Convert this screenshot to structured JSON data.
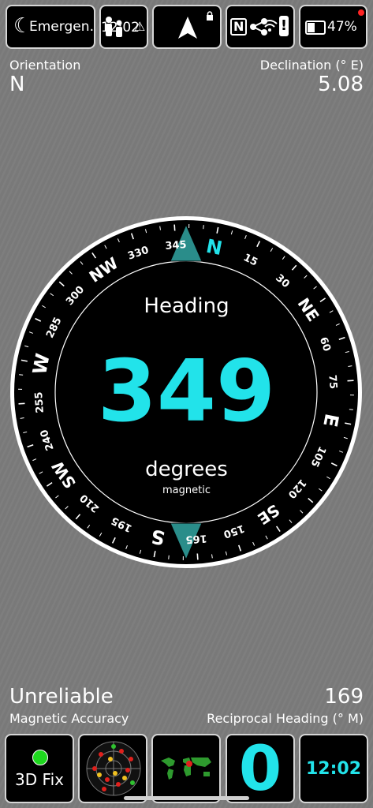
{
  "status_bar": {
    "emergency_text": "Emergen…",
    "time_text": "12:02",
    "warning_glyph": "⚠",
    "nfc_glyph": "N",
    "battery_text": "47%"
  },
  "info_top": {
    "orientation_label": "Orientation",
    "orientation_value": "N",
    "declination_label": "Declination (° E)",
    "declination_value": "5.08"
  },
  "compass": {
    "heading_label": "Heading",
    "heading_value": "349",
    "units_label": "degrees",
    "mode_label": "magnetic",
    "heading_deg": 349,
    "accent_color": "#22e3ea",
    "marker_color": "#2a8d8a",
    "cardinals": [
      {
        "label": "N",
        "bearing": 0
      },
      {
        "label": "NE",
        "bearing": 45
      },
      {
        "label": "E",
        "bearing": 90
      },
      {
        "label": "SE",
        "bearing": 135
      },
      {
        "label": "S",
        "bearing": 180
      },
      {
        "label": "SW",
        "bearing": 225
      },
      {
        "label": "W",
        "bearing": 270
      },
      {
        "label": "NW",
        "bearing": 315
      }
    ],
    "degree_labels": [
      {
        "label": "15",
        "bearing": 15
      },
      {
        "label": "30",
        "bearing": 30
      },
      {
        "label": "60",
        "bearing": 60
      },
      {
        "label": "75",
        "bearing": 75
      },
      {
        "label": "105",
        "bearing": 105
      },
      {
        "label": "120",
        "bearing": 120
      },
      {
        "label": "150",
        "bearing": 150
      },
      {
        "label": "165",
        "bearing": 165
      },
      {
        "label": "195",
        "bearing": 195
      },
      {
        "label": "210",
        "bearing": 210
      },
      {
        "label": "240",
        "bearing": 240
      },
      {
        "label": "255",
        "bearing": 255
      },
      {
        "label": "285",
        "bearing": 285
      },
      {
        "label": "300",
        "bearing": 300
      },
      {
        "label": "330",
        "bearing": 330
      },
      {
        "label": "345",
        "bearing": 345
      }
    ]
  },
  "info_bottom": {
    "accuracy_value": "Unreliable",
    "accuracy_label": "Magnetic Accuracy",
    "reciprocal_value": "169",
    "reciprocal_label": "Reciprocal Heading (° M)"
  },
  "bottom_bar": {
    "gps_fix_label": "3D Fix",
    "satellite_count": "0",
    "clock_time": "12:02",
    "fix_color": "#1ed81e"
  }
}
